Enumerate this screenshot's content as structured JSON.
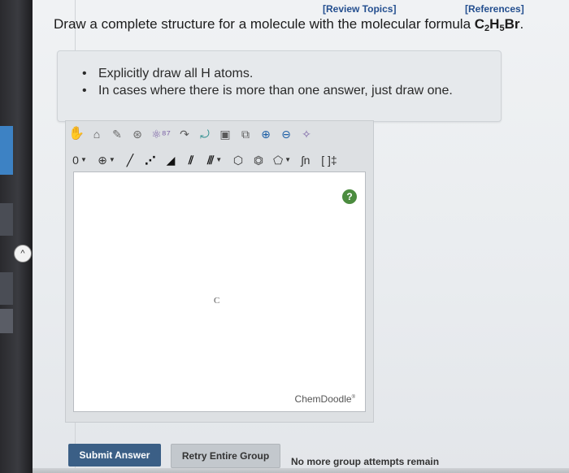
{
  "header": {
    "review_topics": "[Review Topics]",
    "references": "[References]"
  },
  "question": {
    "prefix": "Draw a complete structure for a molecule with the molecular formula ",
    "formula_parts": {
      "c": "C",
      "c_sub": "2",
      "h": "H",
      "h_sub": "5",
      "br": "Br",
      "end": "."
    }
  },
  "hints": [
    "Explicitly draw all H atoms.",
    "In cases where there is more than one answer, just draw one."
  ],
  "editor": {
    "help_label": "?",
    "atom_label": "C",
    "watermark": "ChemDoodle",
    "watermark_mark": "®",
    "row2": {
      "charge_label": "0",
      "plus_label": "⊕",
      "subscript_tool": "ʃn",
      "bracket_tool": "[ ]‡"
    }
  },
  "left_panel": {
    "collapse_label": "^"
  },
  "buttons": {
    "submit": "Submit Answer",
    "retry": "Retry Entire Group"
  },
  "status": {
    "attempts": "No more group attempts remain"
  },
  "colors": {
    "link": "#244f8f",
    "submit_bg": "#3b5f86",
    "help_bg": "#4b8c3f"
  },
  "icons": {
    "row1": [
      "hand-icon",
      "eraser-icon",
      "pen-icon",
      "ring-template-icon",
      "atom-template-icon",
      "rotate-icon",
      "lasso-icon",
      "template-gallery-icon",
      "copy-icon",
      "zoom-in-icon",
      "zoom-out-icon",
      "clean-icon"
    ],
    "row2": [
      "charge-dropdown",
      "plus-charge-dropdown",
      "single-bond-icon",
      "dashed-bond-icon",
      "wedge-bond-icon",
      "double-bond-icon",
      "triple-bond-icon",
      "hexagon-icon",
      "benzene-icon",
      "pentagon-icon",
      "subscript-icon",
      "bracket-icon"
    ]
  }
}
